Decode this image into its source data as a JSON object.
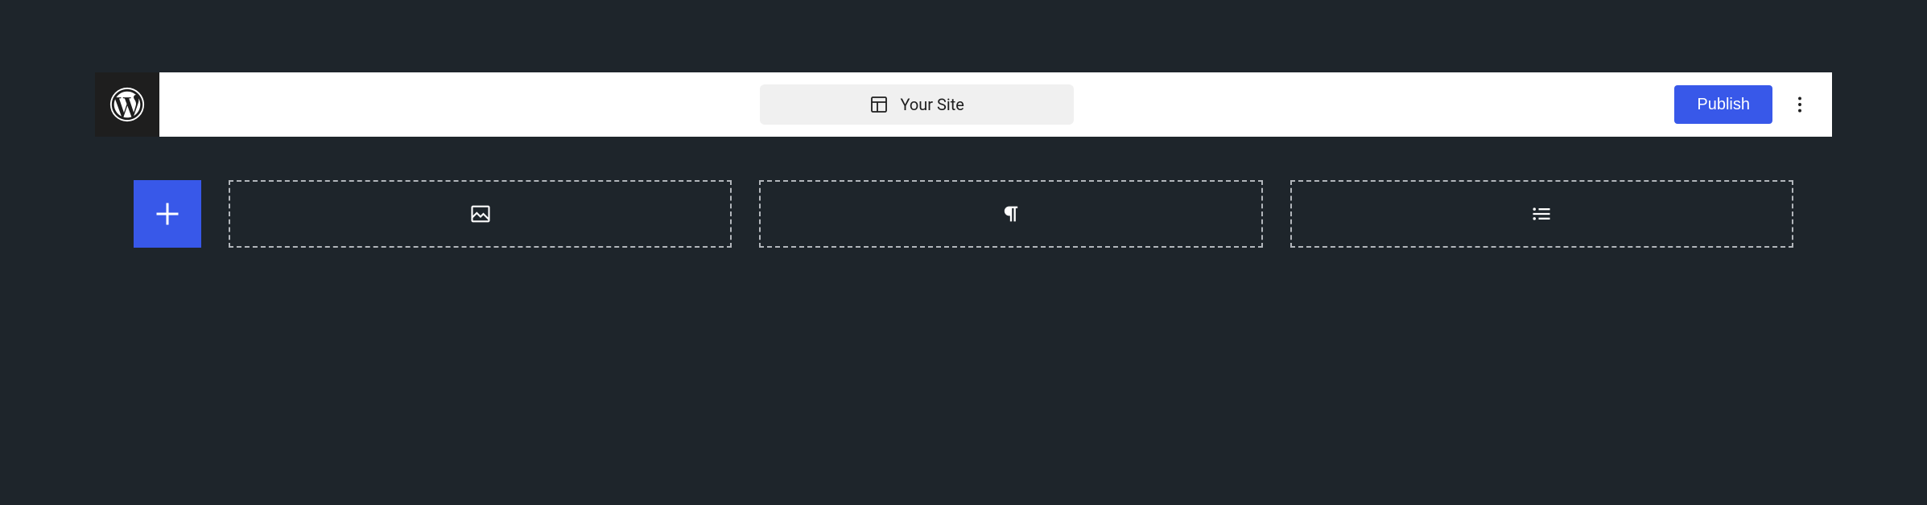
{
  "toolbar": {
    "site_label": "Your Site",
    "publish_label": "Publish"
  },
  "icons": {
    "logo": "wordpress-logo-icon",
    "layout": "layout-icon",
    "more": "more-vertical-icon",
    "add": "plus-icon",
    "image": "image-icon",
    "paragraph": "paragraph-icon",
    "list": "list-icon"
  },
  "colors": {
    "accent": "#3858e9",
    "bg_dark": "#1e252b",
    "toolbar_bg": "#ffffff",
    "chip_bg": "#f0f0f0",
    "logo_bg": "#1e1e1e",
    "dashed_border": "#b2b6bb"
  }
}
